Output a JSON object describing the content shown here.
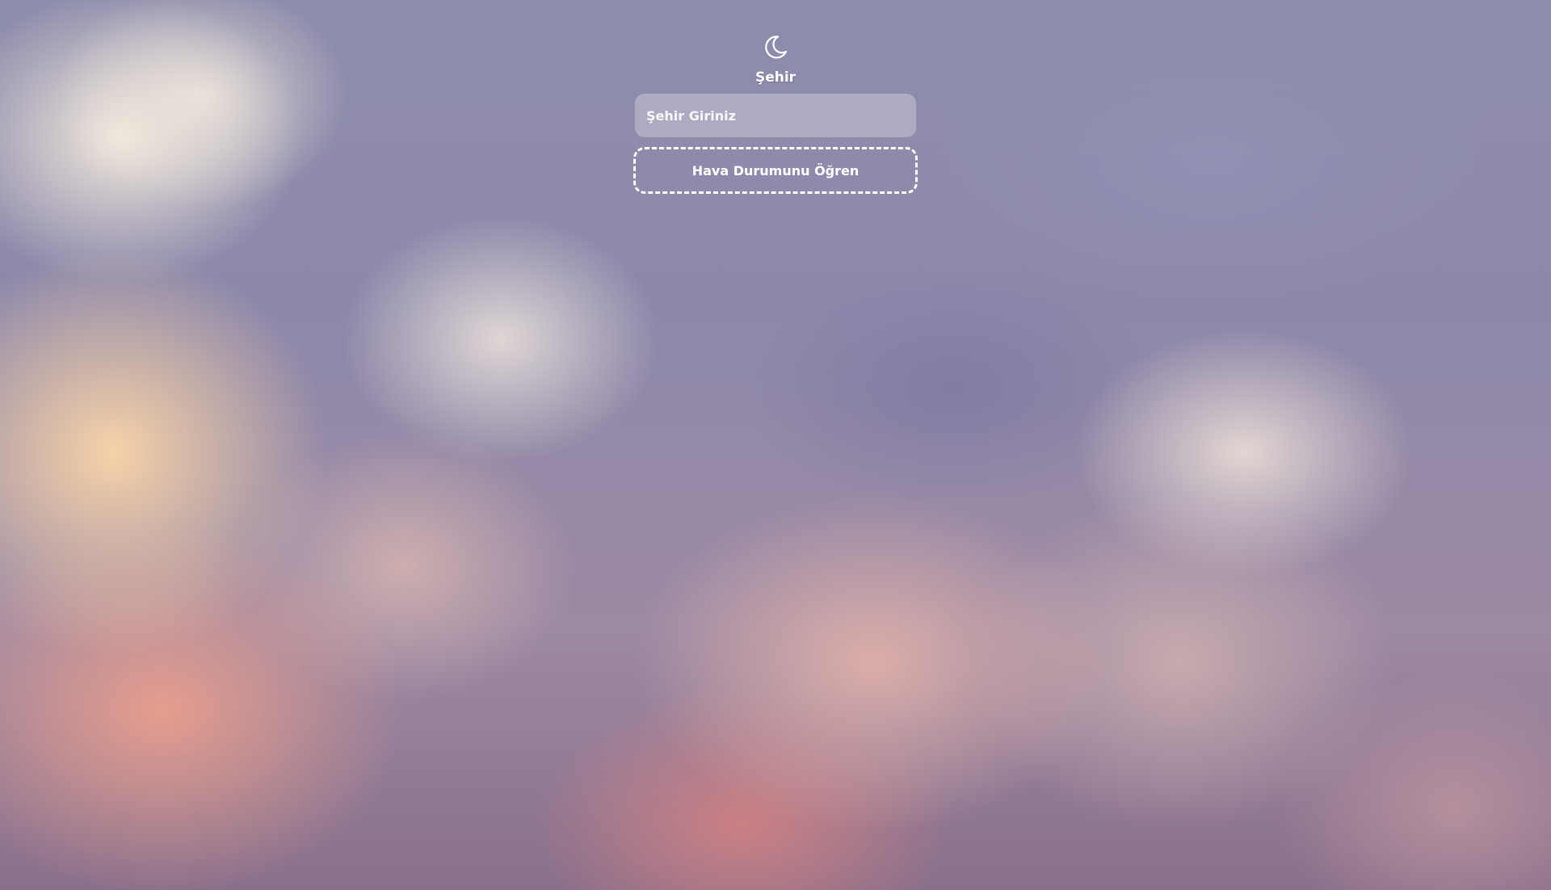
{
  "background": {
    "icon": "clouds-sky-photo",
    "accent_colors": [
      "#8e8dac",
      "#fcd6a8",
      "#eea08c"
    ]
  },
  "header": {
    "icon": "moon-icon"
  },
  "form": {
    "label": "Şehir",
    "city_input": {
      "value": "",
      "placeholder": "Şehir Giriniz"
    },
    "submit_label": "Hava Durumunu Öğren"
  }
}
